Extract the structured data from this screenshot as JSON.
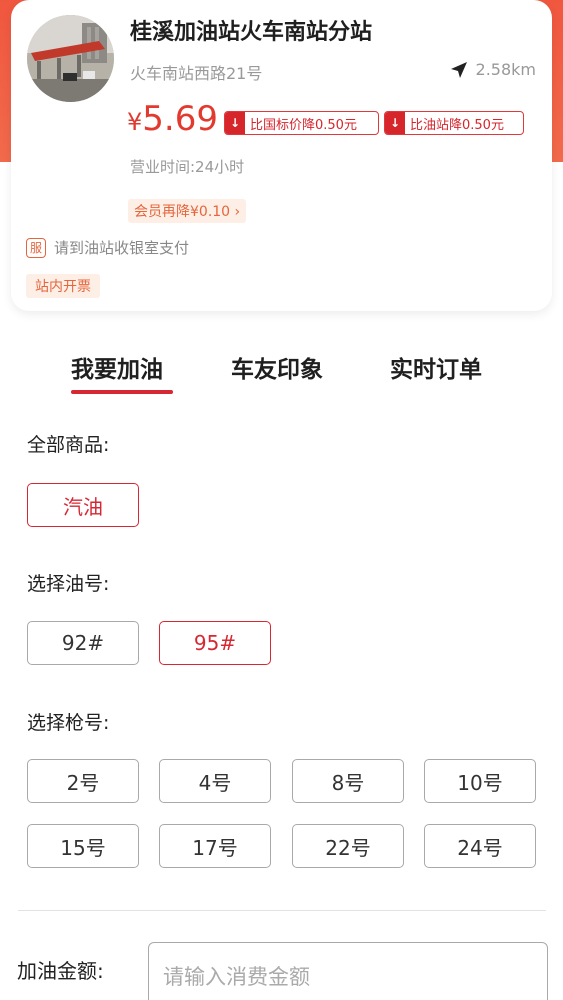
{
  "station": {
    "name": "桂溪加油站火车南站分站",
    "address": "火车南站西路21号",
    "distance": "2.58km",
    "price_symbol": "¥",
    "price": "5.69",
    "badges": [
      {
        "text": "比国标价降0.50元"
      },
      {
        "text": "比油站降0.50元"
      }
    ],
    "hours": "营业时间:24小时",
    "member_discount": "会员再降¥0.10 ›",
    "pay_icon": "服",
    "pay_note": "请到油站收银室支付",
    "invoice_tag": "站内开票"
  },
  "tabs": [
    {
      "label": "我要加油",
      "active": true
    },
    {
      "label": "车友印象",
      "active": false
    },
    {
      "label": "实时订单",
      "active": false
    }
  ],
  "products": {
    "label": "全部商品:",
    "options": [
      {
        "label": "汽油",
        "selected": true
      }
    ]
  },
  "fuel": {
    "label": "选择油号:",
    "options": [
      {
        "label": "92#",
        "selected": false
      },
      {
        "label": "95#",
        "selected": true
      }
    ]
  },
  "nozzle": {
    "label": "选择枪号:",
    "options": [
      {
        "label": "2号"
      },
      {
        "label": "4号"
      },
      {
        "label": "8号"
      },
      {
        "label": "10号"
      },
      {
        "label": "15号"
      },
      {
        "label": "17号"
      },
      {
        "label": "22号"
      },
      {
        "label": "24号"
      }
    ]
  },
  "amount": {
    "label": "加油金额:",
    "placeholder": "请输入消费金额"
  },
  "colors": {
    "accent": "#d62833",
    "header": "#f0573f",
    "tag_bg": "#fdefe6",
    "tag_text": "#e5663d"
  }
}
